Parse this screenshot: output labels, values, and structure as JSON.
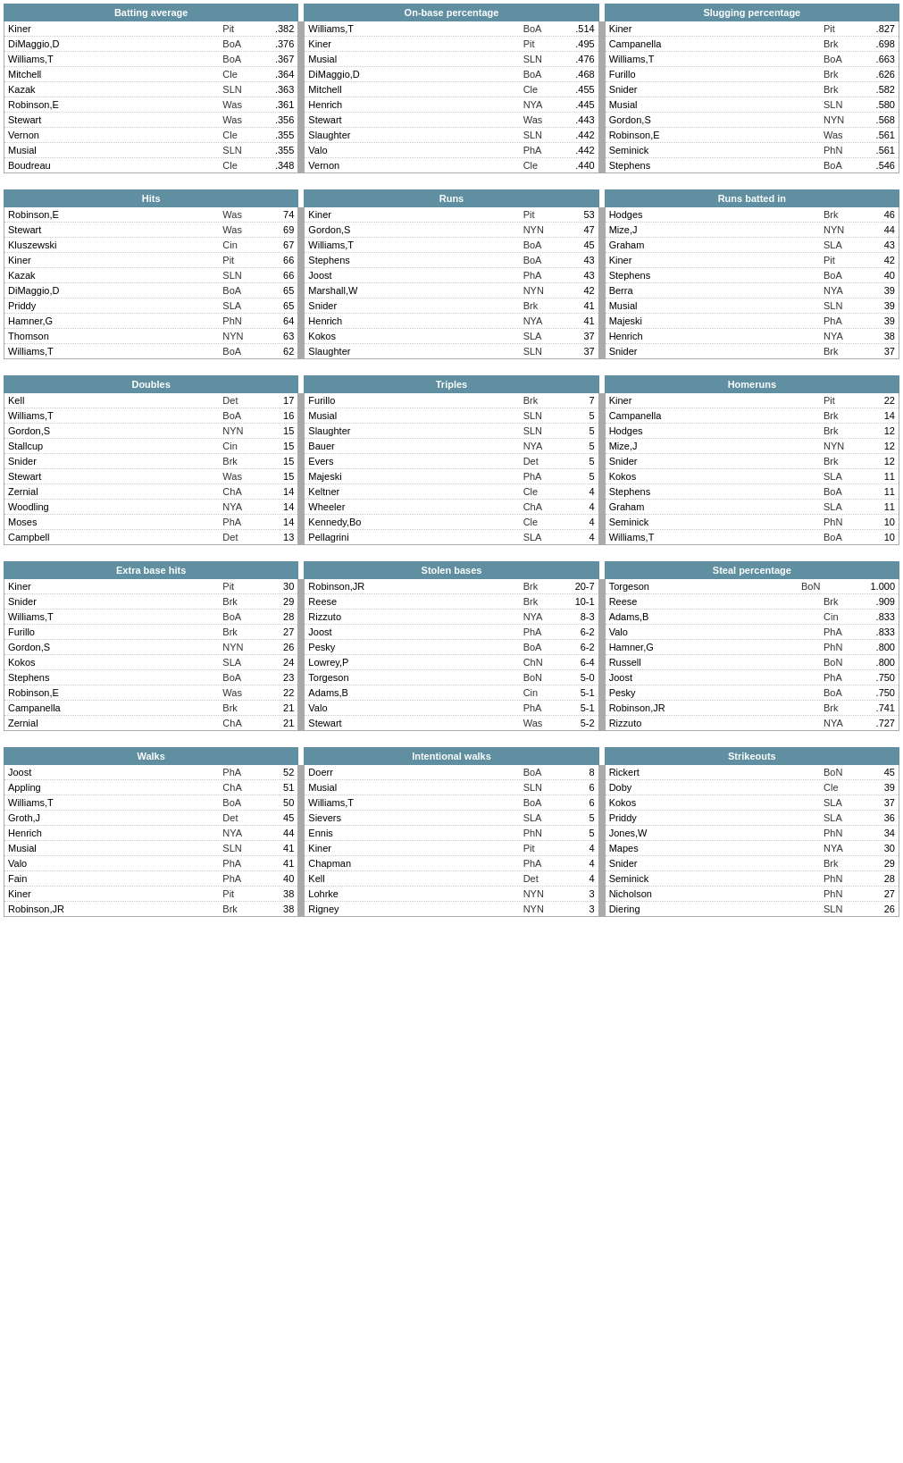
{
  "sections": [
    {
      "id": "batting",
      "headers": [
        "Batting average",
        "On-base percentage",
        "Slugging percentage"
      ],
      "cols": [
        [
          [
            "Kiner",
            "Pit",
            ".382"
          ],
          [
            "DiMaggio,D",
            "BoA",
            ".376"
          ],
          [
            "Williams,T",
            "BoA",
            ".367"
          ],
          [
            "Mitchell",
            "Cle",
            ".364"
          ],
          [
            "Kazak",
            "SLN",
            ".363"
          ],
          [
            "Robinson,E",
            "Was",
            ".361"
          ],
          [
            "Stewart",
            "Was",
            ".356"
          ],
          [
            "Vernon",
            "Cle",
            ".355"
          ],
          [
            "Musial",
            "SLN",
            ".355"
          ],
          [
            "Boudreau",
            "Cle",
            ".348"
          ]
        ],
        [
          [
            "Williams,T",
            "BoA",
            ".514"
          ],
          [
            "Kiner",
            "Pit",
            ".495"
          ],
          [
            "Musial",
            "SLN",
            ".476"
          ],
          [
            "DiMaggio,D",
            "BoA",
            ".468"
          ],
          [
            "Mitchell",
            "Cle",
            ".455"
          ],
          [
            "Henrich",
            "NYA",
            ".445"
          ],
          [
            "Stewart",
            "Was",
            ".443"
          ],
          [
            "Slaughter",
            "SLN",
            ".442"
          ],
          [
            "Valo",
            "PhA",
            ".442"
          ],
          [
            "Vernon",
            "Cle",
            ".440"
          ]
        ],
        [
          [
            "Kiner",
            "Pit",
            ".827"
          ],
          [
            "Campanella",
            "Brk",
            ".698"
          ],
          [
            "Williams,T",
            "BoA",
            ".663"
          ],
          [
            "Furillo",
            "Brk",
            ".626"
          ],
          [
            "Snider",
            "Brk",
            ".582"
          ],
          [
            "Musial",
            "SLN",
            ".580"
          ],
          [
            "Gordon,S",
            "NYN",
            ".568"
          ],
          [
            "Robinson,E",
            "Was",
            ".561"
          ],
          [
            "Seminick",
            "PhN",
            ".561"
          ],
          [
            "Stephens",
            "BoA",
            ".546"
          ]
        ]
      ]
    },
    {
      "id": "hits",
      "headers": [
        "Hits",
        "Runs",
        "Runs batted in"
      ],
      "cols": [
        [
          [
            "Robinson,E",
            "Was",
            "74"
          ],
          [
            "Stewart",
            "Was",
            "69"
          ],
          [
            "Kluszewski",
            "Cin",
            "67"
          ],
          [
            "Kiner",
            "Pit",
            "66"
          ],
          [
            "Kazak",
            "SLN",
            "66"
          ],
          [
            "DiMaggio,D",
            "BoA",
            "65"
          ],
          [
            "Priddy",
            "SLA",
            "65"
          ],
          [
            "Hamner,G",
            "PhN",
            "64"
          ],
          [
            "Thomson",
            "NYN",
            "63"
          ],
          [
            "Williams,T",
            "BoA",
            "62"
          ]
        ],
        [
          [
            "Kiner",
            "Pit",
            "53"
          ],
          [
            "Gordon,S",
            "NYN",
            "47"
          ],
          [
            "Williams,T",
            "BoA",
            "45"
          ],
          [
            "Stephens",
            "BoA",
            "43"
          ],
          [
            "Joost",
            "PhA",
            "43"
          ],
          [
            "Marshall,W",
            "NYN",
            "42"
          ],
          [
            "Snider",
            "Brk",
            "41"
          ],
          [
            "Henrich",
            "NYA",
            "41"
          ],
          [
            "Kokos",
            "SLA",
            "37"
          ],
          [
            "Slaughter",
            "SLN",
            "37"
          ]
        ],
        [
          [
            "Hodges",
            "Brk",
            "46"
          ],
          [
            "Mize,J",
            "NYN",
            "44"
          ],
          [
            "Graham",
            "SLA",
            "43"
          ],
          [
            "Kiner",
            "Pit",
            "42"
          ],
          [
            "Stephens",
            "BoA",
            "40"
          ],
          [
            "Berra",
            "NYA",
            "39"
          ],
          [
            "Musial",
            "SLN",
            "39"
          ],
          [
            "Majeski",
            "PhA",
            "39"
          ],
          [
            "Henrich",
            "NYA",
            "38"
          ],
          [
            "Snider",
            "Brk",
            "37"
          ]
        ]
      ]
    },
    {
      "id": "doubles",
      "headers": [
        "Doubles",
        "Triples",
        "Homeruns"
      ],
      "cols": [
        [
          [
            "Kell",
            "Det",
            "17"
          ],
          [
            "Williams,T",
            "BoA",
            "16"
          ],
          [
            "Gordon,S",
            "NYN",
            "15"
          ],
          [
            "Stallcup",
            "Cin",
            "15"
          ],
          [
            "Snider",
            "Brk",
            "15"
          ],
          [
            "Stewart",
            "Was",
            "15"
          ],
          [
            "Zernial",
            "ChA",
            "14"
          ],
          [
            "Woodling",
            "NYA",
            "14"
          ],
          [
            "Moses",
            "PhA",
            "14"
          ],
          [
            "Campbell",
            "Det",
            "13"
          ]
        ],
        [
          [
            "Furillo",
            "Brk",
            "7"
          ],
          [
            "Musial",
            "SLN",
            "5"
          ],
          [
            "Slaughter",
            "SLN",
            "5"
          ],
          [
            "Bauer",
            "NYA",
            "5"
          ],
          [
            "Evers",
            "Det",
            "5"
          ],
          [
            "Majeski",
            "PhA",
            "5"
          ],
          [
            "Keltner",
            "Cle",
            "4"
          ],
          [
            "Wheeler",
            "ChA",
            "4"
          ],
          [
            "Kennedy,Bo",
            "Cle",
            "4"
          ],
          [
            "Pellagrini",
            "SLA",
            "4"
          ]
        ],
        [
          [
            "Kiner",
            "Pit",
            "22"
          ],
          [
            "Campanella",
            "Brk",
            "14"
          ],
          [
            "Hodges",
            "Brk",
            "12"
          ],
          [
            "Mize,J",
            "NYN",
            "12"
          ],
          [
            "Snider",
            "Brk",
            "12"
          ],
          [
            "Kokos",
            "SLA",
            "11"
          ],
          [
            "Stephens",
            "BoA",
            "11"
          ],
          [
            "Graham",
            "SLA",
            "11"
          ],
          [
            "Seminick",
            "PhN",
            "10"
          ],
          [
            "Williams,T",
            "BoA",
            "10"
          ]
        ]
      ]
    },
    {
      "id": "extra",
      "headers": [
        "Extra base hits",
        "Stolen bases",
        "Steal percentage"
      ],
      "cols": [
        [
          [
            "Kiner",
            "Pit",
            "30"
          ],
          [
            "Snider",
            "Brk",
            "29"
          ],
          [
            "Williams,T",
            "BoA",
            "28"
          ],
          [
            "Furillo",
            "Brk",
            "27"
          ],
          [
            "Gordon,S",
            "NYN",
            "26"
          ],
          [
            "Kokos",
            "SLA",
            "24"
          ],
          [
            "Stephens",
            "BoA",
            "23"
          ],
          [
            "Robinson,E",
            "Was",
            "22"
          ],
          [
            "Campanella",
            "Brk",
            "21"
          ],
          [
            "Zernial",
            "ChA",
            "21"
          ]
        ],
        [
          [
            "Robinson,JR",
            "Brk",
            "20-7"
          ],
          [
            "Reese",
            "Brk",
            "10-1"
          ],
          [
            "Rizzuto",
            "NYA",
            "8-3"
          ],
          [
            "Joost",
            "PhA",
            "6-2"
          ],
          [
            "Pesky",
            "BoA",
            "6-2"
          ],
          [
            "Lowrey,P",
            "ChN",
            "6-4"
          ],
          [
            "Torgeson",
            "BoN",
            "5-0"
          ],
          [
            "Adams,B",
            "Cin",
            "5-1"
          ],
          [
            "Valo",
            "PhA",
            "5-1"
          ],
          [
            "Stewart",
            "Was",
            "5-2"
          ]
        ],
        [
          [
            "Torgeson",
            "BoN",
            "1.000"
          ],
          [
            "Reese",
            "Brk",
            ".909"
          ],
          [
            "Adams,B",
            "Cin",
            ".833"
          ],
          [
            "Valo",
            "PhA",
            ".833"
          ],
          [
            "Hamner,G",
            "PhN",
            ".800"
          ],
          [
            "Russell",
            "BoN",
            ".800"
          ],
          [
            "Joost",
            "PhA",
            ".750"
          ],
          [
            "Pesky",
            "BoA",
            ".750"
          ],
          [
            "Robinson,JR",
            "Brk",
            ".741"
          ],
          [
            "Rizzuto",
            "NYA",
            ".727"
          ]
        ]
      ]
    },
    {
      "id": "walks",
      "headers": [
        "Walks",
        "Intentional walks",
        "Strikeouts"
      ],
      "cols": [
        [
          [
            "Joost",
            "PhA",
            "52"
          ],
          [
            "Appling",
            "ChA",
            "51"
          ],
          [
            "Williams,T",
            "BoA",
            "50"
          ],
          [
            "Groth,J",
            "Det",
            "45"
          ],
          [
            "Henrich",
            "NYA",
            "44"
          ],
          [
            "Musial",
            "SLN",
            "41"
          ],
          [
            "Valo",
            "PhA",
            "41"
          ],
          [
            "Fain",
            "PhA",
            "40"
          ],
          [
            "Kiner",
            "Pit",
            "38"
          ],
          [
            "Robinson,JR",
            "Brk",
            "38"
          ]
        ],
        [
          [
            "Doerr",
            "BoA",
            "8"
          ],
          [
            "Musial",
            "SLN",
            "6"
          ],
          [
            "Williams,T",
            "BoA",
            "6"
          ],
          [
            "Sievers",
            "SLA",
            "5"
          ],
          [
            "Ennis",
            "PhN",
            "5"
          ],
          [
            "Kiner",
            "Pit",
            "4"
          ],
          [
            "Chapman",
            "PhA",
            "4"
          ],
          [
            "Kell",
            "Det",
            "4"
          ],
          [
            "Lohrke",
            "NYN",
            "3"
          ],
          [
            "Rigney",
            "NYN",
            "3"
          ]
        ],
        [
          [
            "Rickert",
            "BoN",
            "45"
          ],
          [
            "Doby",
            "Cle",
            "39"
          ],
          [
            "Kokos",
            "SLA",
            "37"
          ],
          [
            "Priddy",
            "SLA",
            "36"
          ],
          [
            "Jones,W",
            "PhN",
            "34"
          ],
          [
            "Mapes",
            "NYA",
            "30"
          ],
          [
            "Snider",
            "Brk",
            "29"
          ],
          [
            "Seminick",
            "PhN",
            "28"
          ],
          [
            "Nicholson",
            "PhN",
            "27"
          ],
          [
            "Diering",
            "SLN",
            "26"
          ]
        ]
      ]
    }
  ]
}
